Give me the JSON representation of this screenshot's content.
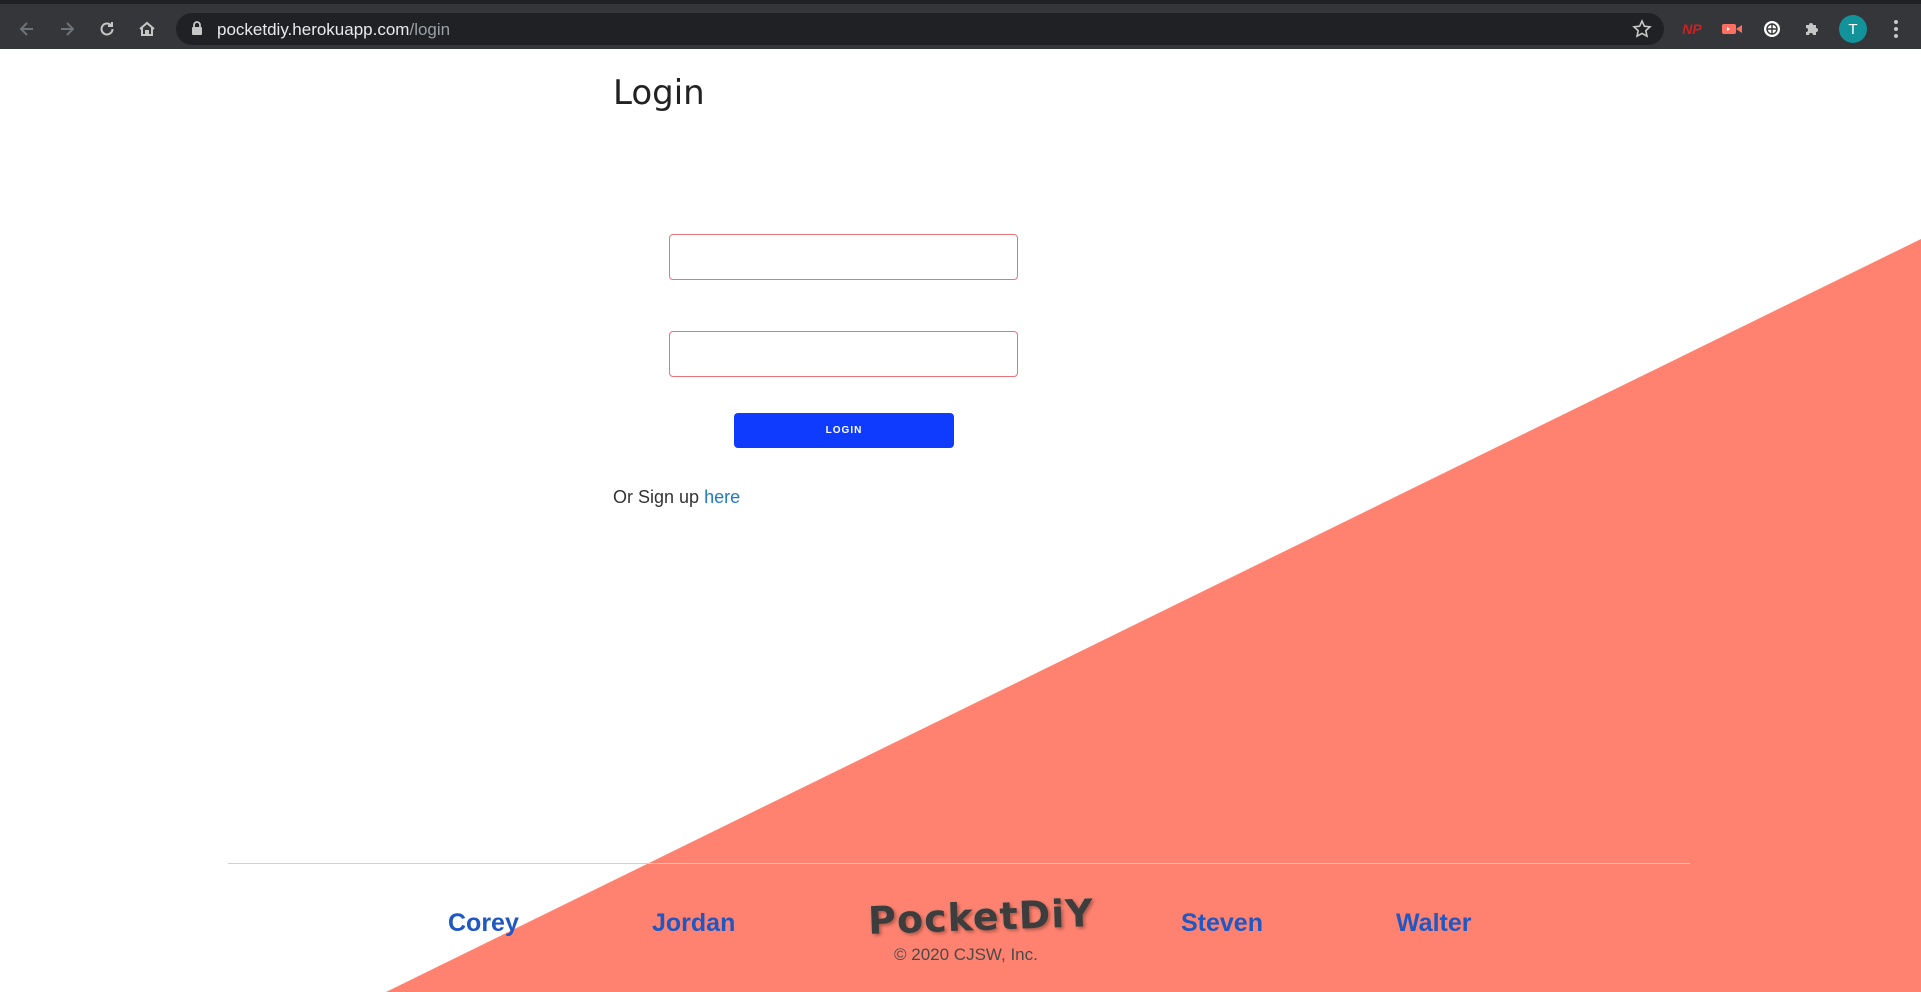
{
  "browser": {
    "url_host": "pocketdiy.herokuapp.com",
    "url_path": "/login",
    "profile_initial": "T",
    "extension_np_label": "NP",
    "icons": [
      "back-icon",
      "forward-icon",
      "reload-icon",
      "home-icon",
      "lock-icon",
      "star-icon",
      "puzzle-icon",
      "menu-icon"
    ]
  },
  "login": {
    "title": "Login",
    "username_value": "",
    "password_value": "",
    "button_label": "LOGIN",
    "signup_prefix": "Or Sign up",
    "signup_link": "here"
  },
  "footer": {
    "names": [
      "Corey",
      "Jordan",
      "Steven",
      "Walter"
    ],
    "logo": "PocketDiY",
    "copyright": "© 2020 CJSW, Inc."
  },
  "colors": {
    "accent_salmon": "#ff8270",
    "button_blue": "#0f3bff",
    "link_blue": "#1f7bbf",
    "footer_name_blue": "#1f57c3",
    "field_border": "#e8747a"
  }
}
